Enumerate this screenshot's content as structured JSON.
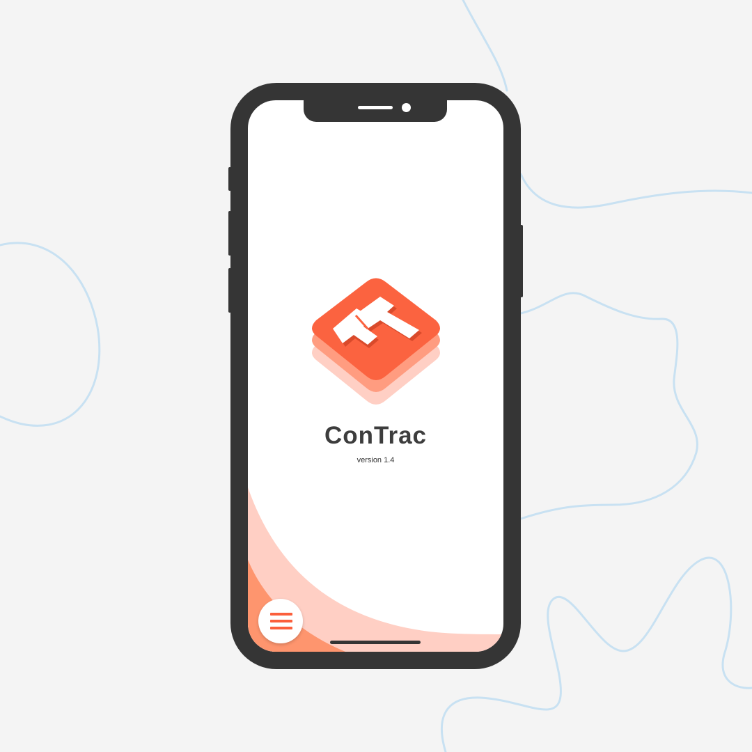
{
  "app": {
    "name": "ConTrac",
    "version": "version 1.4"
  },
  "icons": {
    "logo": "contrac-ct-logo",
    "menu": "hamburger-menu-icon"
  },
  "colors": {
    "background": "#f4f4f4",
    "phone_frame": "#353535",
    "accent": "#fb6340",
    "accent_light": "#ffcfc4",
    "wave_line": "#c8e1f2",
    "title_text": "#3d3d3d"
  }
}
